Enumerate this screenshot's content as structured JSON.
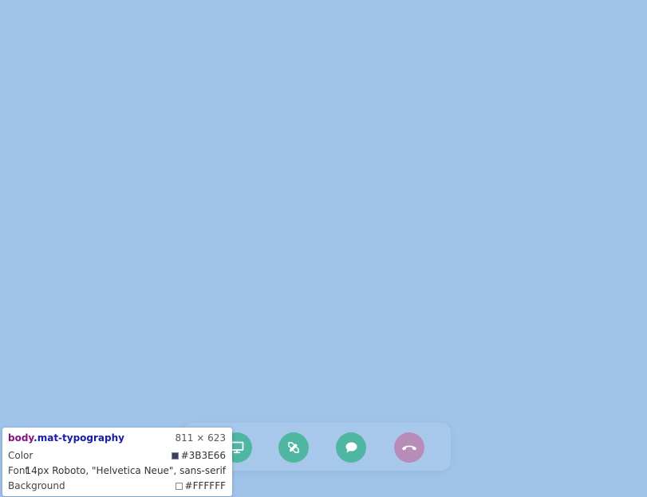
{
  "page": {
    "background_color": "#A0C4E9"
  },
  "controls": [
    {
      "name": "screen-share",
      "icon": "monitor-icon",
      "color": "#4FB6A2"
    },
    {
      "name": "whiteboard",
      "icon": "pencil-ruler-icon",
      "color": "#4FB6A2"
    },
    {
      "name": "chat",
      "icon": "chat-bubble-icon",
      "color": "#4FB6A2"
    },
    {
      "name": "hang-up",
      "icon": "phone-hangup-icon",
      "color": "#B88CB8"
    }
  ],
  "inspector": {
    "tag": "body",
    "class": ".mat-typography",
    "dimensions": "811 × 623",
    "color_label": "Color",
    "color_value": "#3B3E66",
    "font_label": "Font",
    "font_value": "14px Roboto, \"Helvetica Neue\", sans-serif",
    "background_label": "Background",
    "background_value": "#FFFFFF"
  }
}
